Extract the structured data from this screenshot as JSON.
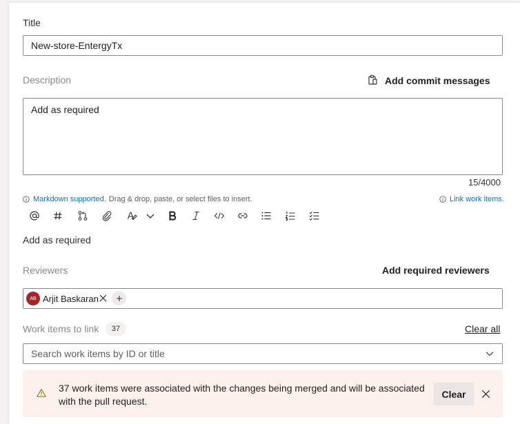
{
  "form": {
    "title_label": "Title",
    "title_value": "New-store-EntergyTx",
    "description_label": "Description",
    "add_commit_messages_label": "Add commit messages",
    "description_value": "Add as required",
    "char_count": "15/4000",
    "markdown_link": "Markdown supported.",
    "markdown_hint": "Drag & drop, paste, or select files to insert.",
    "link_work_items_label": "Link work items.",
    "preview_text": "Add as required"
  },
  "toolbar": {
    "icons": [
      "mention-icon",
      "hashtag-icon",
      "pull-request-icon",
      "attach-icon",
      "highlight-icon",
      "chevron-down-icon",
      "bold-icon",
      "italic-icon",
      "code-icon",
      "link-icon",
      "bullet-list-icon",
      "numbered-list-icon",
      "task-list-icon"
    ]
  },
  "reviewers": {
    "label": "Reviewers",
    "add_required_label": "Add required reviewers",
    "chip_initials": "AB",
    "chip_name": "Arjit Baskaran"
  },
  "work_items": {
    "label": "Work items to link",
    "count": "37",
    "clear_all_label": "Clear all",
    "search_placeholder": "Search work items by ID or title"
  },
  "banner": {
    "message_line1": "37 work items were associated with the changes being merged and will be associated",
    "message_line2": "with the pull request.",
    "clear_label": "Clear"
  },
  "colors": {
    "link": "#106ebe",
    "warning_bg": "#fbf0ec",
    "warning_icon": "#c19c00",
    "avatar": "#a4262c"
  }
}
